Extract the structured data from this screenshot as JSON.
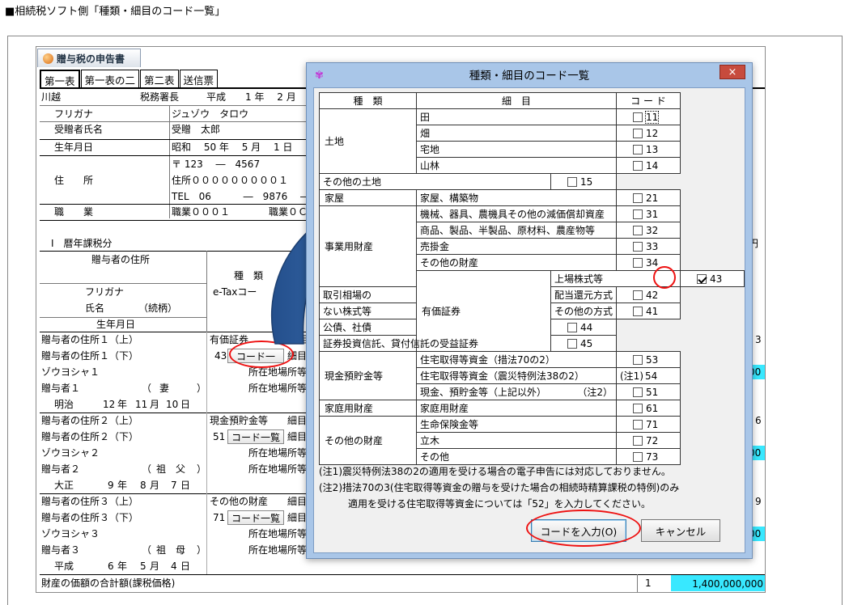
{
  "caption": "■相続税ソフト側「種類・細目のコード一覧」",
  "app": {
    "tab_title": "贈与税の申告書",
    "sheet_tabs": [
      "第一表",
      "第一表の二",
      "第二表",
      "送信票"
    ],
    "header": {
      "office": "川越",
      "office_suffix": "税務署長",
      "era_date": "平成　　1 年　 2 月",
      "furigana_label": "フリガナ",
      "furigana_value": "ジュゾウ　タロウ",
      "name_label": "受贈者氏名",
      "name_value": "受贈　太郎",
      "birth_label": "生年月日",
      "birth_value": "昭和　 50 年　 5 月　 1 日",
      "postal": "〒 123　 ―　4567",
      "address_label": "住　　所",
      "address_value": "住所０００００００００１",
      "tel": "TEL　06　　　 ―　9876　 ―",
      "job_label": "職　　業",
      "job_value": "職業０００１　　　　職業０Ｃ"
    },
    "section": "Ⅰ　暦年課税分",
    "grid_headers": {
      "donor_address": "贈与者の住所",
      "type": "種　類",
      "etax_code": "e-Taxコー",
      "furigana": "フリガナ",
      "name": "氏名　　　　（続柄）",
      "birth": "生年月日",
      "location": "所"
    },
    "donors": [
      {
        "addr1": "贈与者の住所１（上）",
        "addr2": "贈与者の住所１（下）",
        "kana": "ゾウヨシャ１",
        "name": "贈与者１",
        "relation": "妻",
        "era": "明治",
        "y": "12",
        "m": "11",
        "d": "10",
        "type": "有価証券",
        "code": "43",
        "code_btn": "コード一",
        "detail": "細目",
        "loc1": "所在地場所等",
        "loc2": "所在地場所等",
        "right_value": "3"
      },
      {
        "addr1": "贈与者の住所２（上）",
        "addr2": "贈与者の住所２（下）",
        "kana": "ゾウヨシャ２",
        "name": "贈与者２",
        "relation": "祖　父",
        "era": "大正",
        "y": "9",
        "m": "8",
        "d": "7",
        "type": "現金預貯金等",
        "code": "51",
        "code_btn": "コード一覧",
        "detail": "細目",
        "loc1": "所在地場所等",
        "loc2": "所在地場所等",
        "right_value": "6"
      },
      {
        "addr1": "贈与者の住所３（上）",
        "addr2": "贈与者の住所３（下）",
        "kana": "ゾウヨシャ３",
        "name": "贈与者３",
        "relation": "祖　母",
        "era": "平成",
        "y": "6",
        "m": "5",
        "d": "4",
        "type": "その他の財産",
        "code": "71",
        "code_btn": "コード一覧",
        "detail": "細目",
        "loc1": "所在地場所等",
        "loc2": "所在地場所等",
        "right_value": "9"
      }
    ],
    "date_units": {
      "y": "年",
      "m": "月",
      "d": "日"
    },
    "right_unit": "円",
    "right_cyan_values": [
      "00",
      "00",
      "00"
    ],
    "total_label": "財産の価額の合計額(課税価格)",
    "total_index": "1",
    "total_value": "1,400,000,000"
  },
  "dialog": {
    "title": "種類・細目のコード一覧",
    "close_label": "×",
    "headers": {
      "kind": "種　類",
      "item": "細　目",
      "code": "コ ー ド"
    },
    "rows": [
      {
        "kind": "土地",
        "span": 4,
        "item": "田",
        "code": "11",
        "checked": false,
        "focus": true
      },
      {
        "item": "畑",
        "code": "12",
        "checked": false
      },
      {
        "item": "宅地",
        "code": "13",
        "checked": false
      },
      {
        "item": "山林",
        "code": "14",
        "checked": false
      },
      {
        "item": "その他の土地",
        "code": "15",
        "checked": false
      },
      {
        "kind": "家屋",
        "span": 1,
        "item": "家屋、構築物",
        "code": "21",
        "checked": false
      },
      {
        "kind": "事業用財産",
        "span": 5,
        "item": "機械、器具、農機具その他の減価償却資産",
        "code": "31",
        "checked": false
      },
      {
        "item": "商品、製品、半製品、原材料、農産物等",
        "code": "32",
        "checked": false
      },
      {
        "item": "売掛金",
        "code": "33",
        "checked": false
      },
      {
        "item": "その他の財産",
        "code": "34",
        "checked": false
      },
      {
        "kind": "有価証券",
        "span": 5,
        "item": "上場株式等",
        "code": "43",
        "checked": true
      },
      {
        "item_a": "取引相場の",
        "item_b": "配当還元方式",
        "code": "42",
        "checked": false
      },
      {
        "item_a": "ない株式等",
        "item_b": "その他の方式",
        "code": "41",
        "checked": false
      },
      {
        "item": "公債、社債",
        "code": "44",
        "checked": false
      },
      {
        "item": "証券投資信託、貸付信託の受益証券",
        "code": "45",
        "checked": false
      },
      {
        "kind": "現金預貯金等",
        "span": 3,
        "item": "住宅取得等資金（措法70の2）",
        "code": "53",
        "checked": false
      },
      {
        "item": "住宅取得等資金（震災特例法38の2）",
        "code": "54",
        "checked": false,
        "prefix": "(注1)"
      },
      {
        "item": "現金、預貯金等（上記以外）",
        "suffix": "（注2）",
        "code": "51",
        "checked": false
      },
      {
        "kind": "家庭用財産",
        "span": 1,
        "item": "家庭用財産",
        "code": "61",
        "checked": false
      },
      {
        "kind": "その他の財産",
        "span": 3,
        "item": "生命保険金等",
        "code": "71",
        "checked": false
      },
      {
        "item": "立木",
        "code": "72",
        "checked": false
      },
      {
        "item": "その他",
        "code": "73",
        "checked": false
      }
    ],
    "notes": [
      "(注1)震災特例法38の2の適用を受ける場合の電子申告には対応しておりません。",
      "(注2)措法70の3(住宅取得等資金の贈与を受けた場合の相続時精算課税の特例)のみ",
      "　　　適用を受ける住宅取得等資金については「52」を入力してください。"
    ],
    "ok_label": "コードを入力(O)",
    "cancel_label": "キャンセル"
  },
  "colors": {
    "cyan": "#38e8ff",
    "annotation_red": "#e11111",
    "arrow_blue": "#2f6db5"
  }
}
